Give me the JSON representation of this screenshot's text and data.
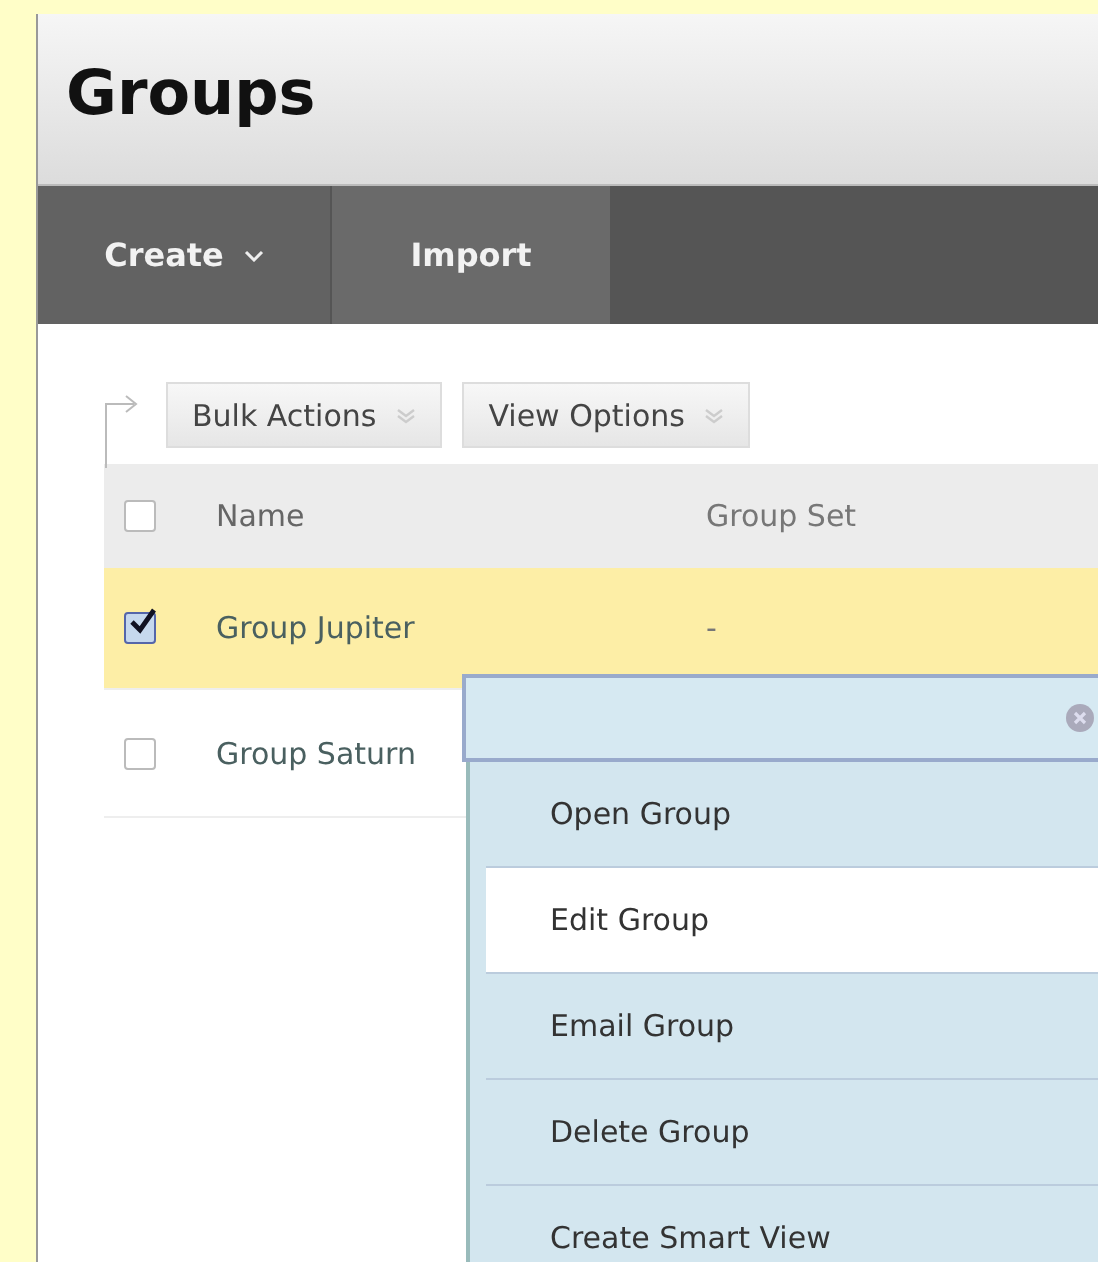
{
  "page_title": "Groups",
  "toolbar": [
    {
      "label": "Create",
      "has_caret": true,
      "selected": true
    },
    {
      "label": "Import",
      "has_caret": false,
      "selected": false
    }
  ],
  "action_buttons": [
    "Bulk Actions",
    "View Options"
  ],
  "table": {
    "columns": [
      "Name",
      "Group Set"
    ],
    "header_checked": false,
    "rows": [
      {
        "name": "Group Jupiter",
        "group_set": "-",
        "checked": true
      },
      {
        "name": "Group Saturn",
        "checked": false
      }
    ]
  },
  "context_menu": {
    "items": [
      {
        "label": "Open Group",
        "highlighted": false
      },
      {
        "label": "Edit Group",
        "highlighted": true
      },
      {
        "label": "Email Group",
        "highlighted": false
      },
      {
        "label": "Delete Group",
        "highlighted": false
      },
      {
        "label": "Create Smart View",
        "highlighted": false
      }
    ]
  }
}
